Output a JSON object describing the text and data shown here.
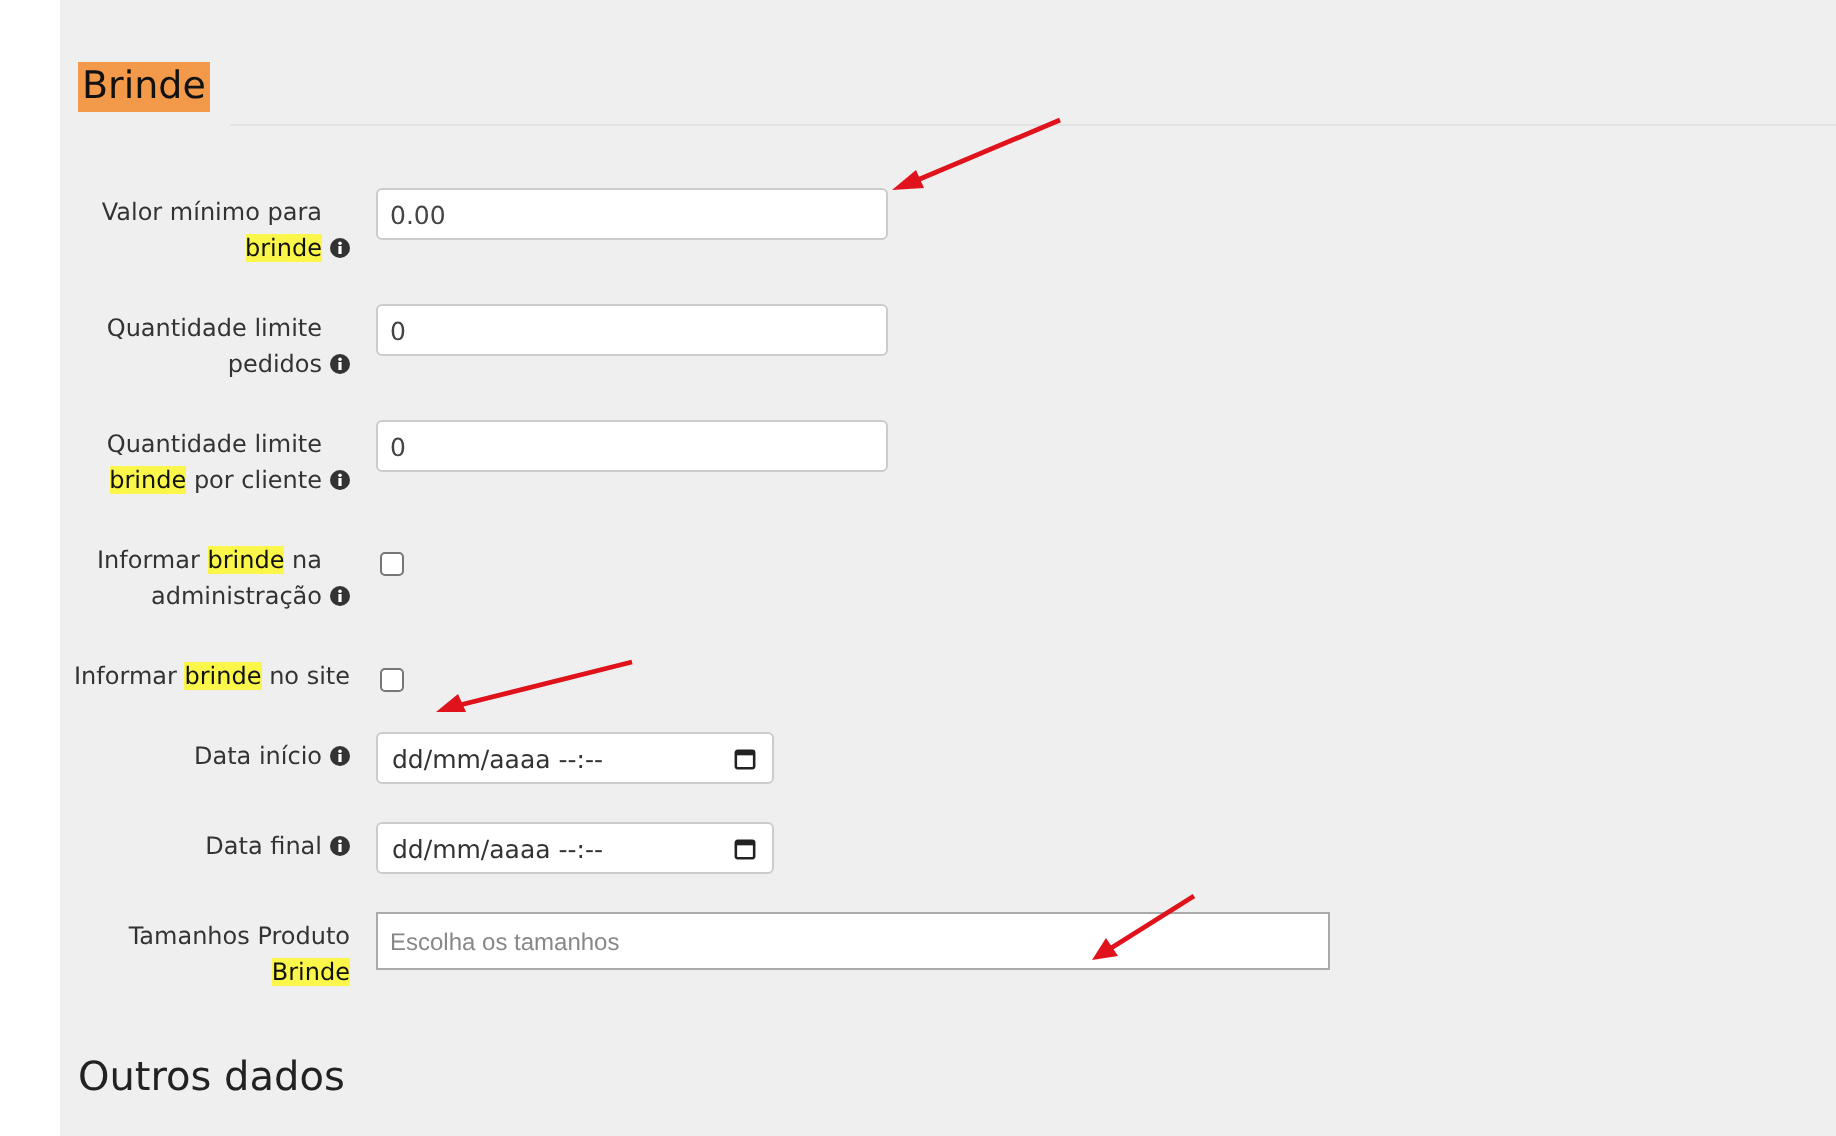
{
  "section_title": "Brinde",
  "fields": [
    {
      "kind": "text",
      "label": "Valor mínimo para **brinde**",
      "info": true,
      "value": "0.00"
    },
    {
      "kind": "text",
      "label": "Quantidade limite pedidos",
      "info": true,
      "value": "0"
    },
    {
      "kind": "text",
      "label": "Quantidade limite **brinde** por cliente",
      "info": true,
      "value": "0"
    },
    {
      "kind": "checkbox",
      "label": "Informar **brinde** na administração",
      "info": true,
      "checked": false
    },
    {
      "kind": "checkbox",
      "label": "Informar **brinde** no site",
      "info": false,
      "checked": false
    },
    {
      "kind": "datetime",
      "label": "Data início",
      "info": true,
      "value": "dd/mm/aaaa --:--"
    },
    {
      "kind": "datetime",
      "label": "Data final",
      "info": true,
      "value": "dd/mm/aaaa --:--"
    },
    {
      "kind": "multiselect",
      "label": "Tamanhos Produto **Brinde**",
      "info": false,
      "placeholder": "Escolha os tamanhos"
    }
  ],
  "next_section_title": "Outros dados"
}
